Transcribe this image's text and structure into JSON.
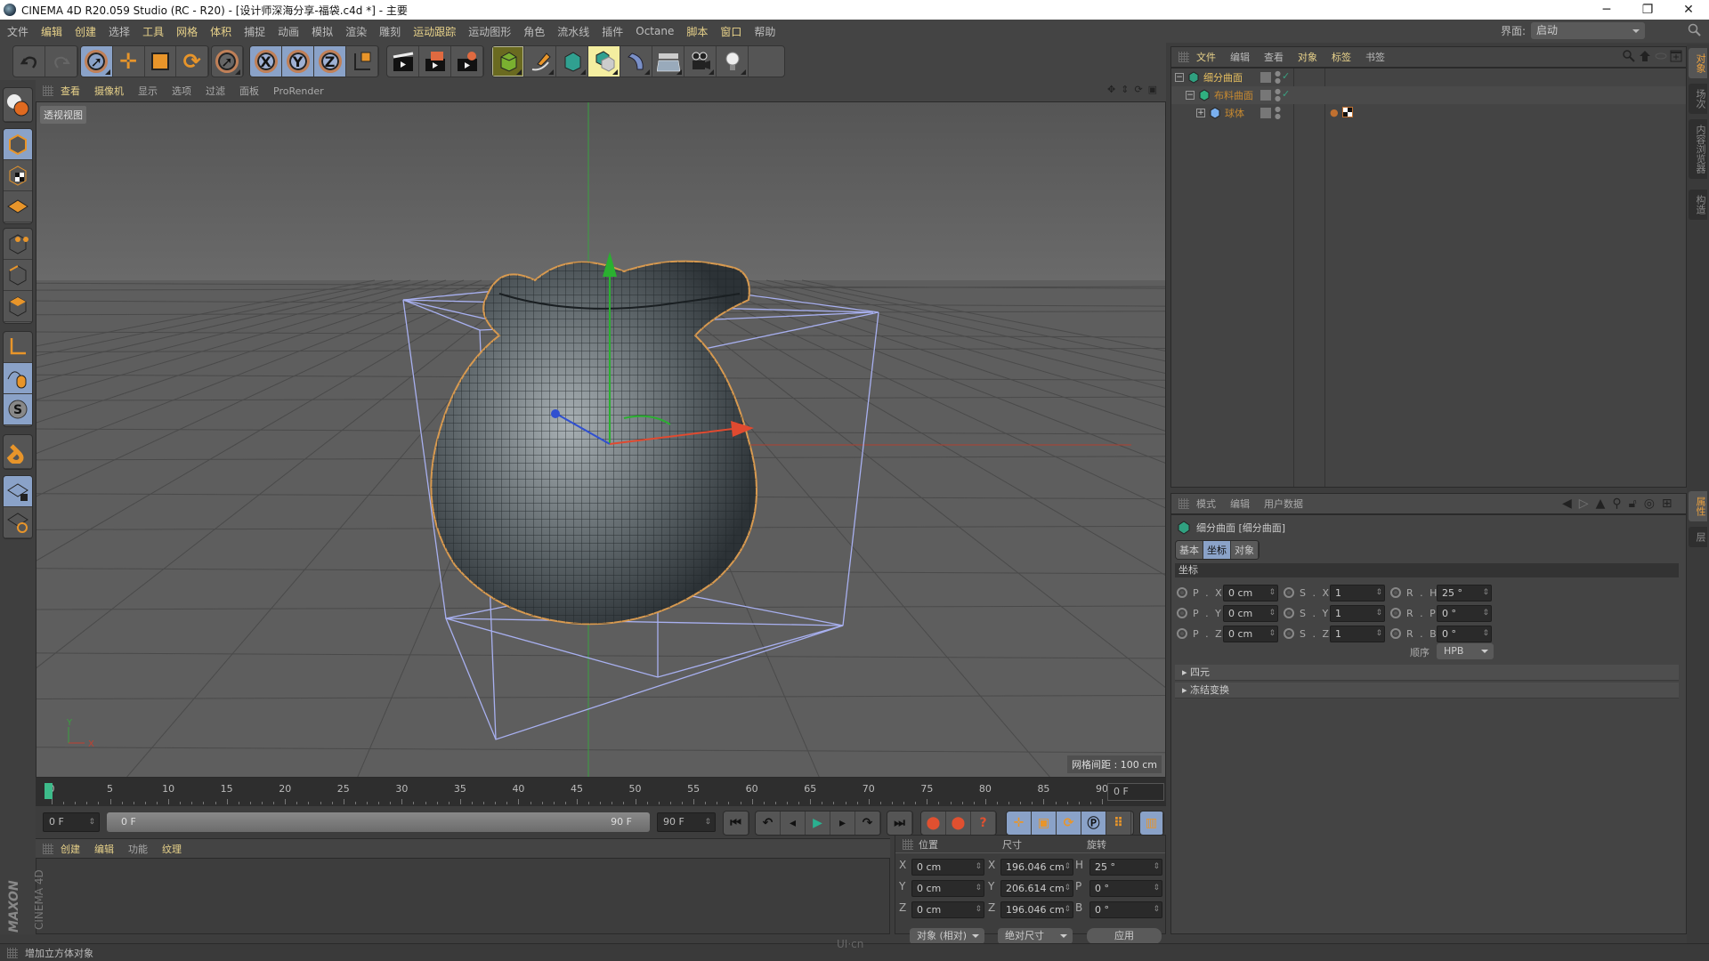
{
  "window": {
    "title": "CINEMA 4D R20.059 Studio (RC - R20) - [设计师深海分享-福袋.c4d *] - 主要",
    "controls": {
      "minimize": "─",
      "restore": "❐",
      "close": "✕"
    }
  },
  "menubar": {
    "items": [
      {
        "label": "文件",
        "hl": false
      },
      {
        "label": "编辑",
        "hl": true
      },
      {
        "label": "创建",
        "hl": true
      },
      {
        "label": "选择",
        "hl": false
      },
      {
        "label": "工具",
        "hl": true
      },
      {
        "label": "网格",
        "hl": true
      },
      {
        "label": "体积",
        "hl": true
      },
      {
        "label": "捕捉",
        "hl": false
      },
      {
        "label": "动画",
        "hl": false
      },
      {
        "label": "模拟",
        "hl": false
      },
      {
        "label": "渲染",
        "hl": false
      },
      {
        "label": "雕刻",
        "hl": false
      },
      {
        "label": "运动跟踪",
        "hl": true
      },
      {
        "label": "运动图形",
        "hl": false
      },
      {
        "label": "角色",
        "hl": false
      },
      {
        "label": "流水线",
        "hl": false
      },
      {
        "label": "插件",
        "hl": false
      },
      {
        "label": "Octane",
        "hl": false
      },
      {
        "label": "脚本",
        "hl": true
      },
      {
        "label": "窗口",
        "hl": true
      },
      {
        "label": "帮助",
        "hl": false
      }
    ],
    "layout_label": "界面:",
    "layout_value": "启动"
  },
  "toolbar": {
    "icons": [
      "undo-icon",
      "redo-icon",
      "live-selection-icon",
      "move-icon",
      "scale-icon",
      "rotate-icon",
      "recent-tool-icon",
      "x-axis-lock-icon",
      "y-axis-lock-icon",
      "z-axis-lock-icon",
      "coordinate-system-icon",
      "render-view-icon",
      "render-picture-viewer-icon",
      "render-settings-icon",
      "cube-icon",
      "pen-spline-icon",
      "subdivision-surface-icon",
      "cloner-icon",
      "deformer-icon",
      "floor-icon",
      "camera-icon",
      "light-icon"
    ],
    "axis_labels": [
      "X",
      "Y",
      "Z"
    ]
  },
  "leftbar": {
    "icons": [
      "make-editable-icon",
      "model-mode-icon",
      "texture-mode-icon",
      "workplane-mode-icon",
      "points-mode-icon",
      "edges-mode-icon",
      "polygons-mode-icon",
      "axis-mode-icon",
      "tweak-mode-icon",
      "solo-icon",
      "snap-icon",
      "workplane-lock-icon",
      "workplane-align-icon"
    ]
  },
  "viewport": {
    "menu": [
      {
        "label": "查看",
        "hl": true
      },
      {
        "label": "摄像机",
        "hl": true
      },
      {
        "label": "显示",
        "hl": false
      },
      {
        "label": "选项",
        "hl": false
      },
      {
        "label": "过滤",
        "hl": false
      },
      {
        "label": "面板",
        "hl": false
      },
      {
        "label": "ProRender",
        "hl": false
      }
    ],
    "view_name": "透视视图",
    "grid_spacing": "网格间距 : 100 cm",
    "axis_labels": {
      "x": "X",
      "y": "Y",
      "z": "Z"
    }
  },
  "timeline": {
    "ticks": [
      0,
      5,
      10,
      15,
      20,
      25,
      30,
      35,
      40,
      45,
      50,
      55,
      60,
      65,
      70,
      75,
      80,
      85,
      90
    ],
    "current_frame": "0 F",
    "start_field": "0 F",
    "range_start": "0 F",
    "range_end": "90 F",
    "end_field": "90 F",
    "max_frame": 90
  },
  "material_panel": {
    "menu": [
      {
        "label": "创建",
        "hl": true
      },
      {
        "label": "编辑",
        "hl": true
      },
      {
        "label": "功能",
        "hl": false
      },
      {
        "label": "纹理",
        "hl": true
      }
    ],
    "brand_top": "MAXON",
    "brand_bottom": "CINEMA 4D"
  },
  "coordinates": {
    "headers": {
      "position": "位置",
      "size": "尺寸",
      "rotation": "旋转"
    },
    "rows": [
      {
        "axis": "X",
        "pos": "0 cm",
        "size_axis": "X",
        "size": "196.046 cm",
        "rot_axis": "H",
        "rot": "25 °"
      },
      {
        "axis": "Y",
        "pos": "0 cm",
        "size_axis": "Y",
        "size": "206.614 cm",
        "rot_axis": "P",
        "rot": "0 °"
      },
      {
        "axis": "Z",
        "pos": "0 cm",
        "size_axis": "Z",
        "size": "196.046 cm",
        "rot_axis": "B",
        "rot": "0 °"
      }
    ],
    "mode_dropdown": "对象 (相对)",
    "size_dropdown": "绝对尺寸",
    "apply_button": "应用"
  },
  "object_manager": {
    "menu": [
      {
        "label": "文件",
        "hl": true
      },
      {
        "label": "编辑",
        "hl": false
      },
      {
        "label": "查看",
        "hl": false
      },
      {
        "label": "对象",
        "hl": true
      },
      {
        "label": "标签",
        "hl": true
      },
      {
        "label": "书签",
        "hl": false
      }
    ],
    "objects": [
      {
        "name": "细分曲面",
        "color": "#e8c060",
        "indent": 0,
        "expand": "−",
        "enabled": true
      },
      {
        "name": "布料曲面",
        "color": "#c88a30",
        "indent": 1,
        "expand": "−",
        "enabled": true
      },
      {
        "name": "球体",
        "color": "#c88a30",
        "indent": 2,
        "expand": "+",
        "enabled": false
      }
    ]
  },
  "right_tabs": {
    "top": [
      {
        "label": "对象",
        "active": true
      },
      {
        "label": "场次",
        "active": false
      },
      {
        "label": "内容浏览器",
        "active": false
      },
      {
        "label": "构造",
        "active": false
      }
    ],
    "bottom": [
      {
        "label": "属性",
        "active": true
      },
      {
        "label": "层",
        "active": false
      }
    ]
  },
  "attribute_manager": {
    "menu": [
      "模式",
      "编辑",
      "用户数据"
    ],
    "object_title": "细分曲面 [细分曲面]",
    "tabs": [
      {
        "label": "基本",
        "active": false
      },
      {
        "label": "坐标",
        "active": true
      },
      {
        "label": "对象",
        "active": false
      }
    ],
    "section": "坐标",
    "params": [
      [
        {
          "label": "P . X",
          "value": "0 cm"
        },
        {
          "label": "S . X",
          "value": "1"
        },
        {
          "label": "R . H",
          "value": "25 °"
        }
      ],
      [
        {
          "label": "P . Y",
          "value": "0 cm"
        },
        {
          "label": "S . Y",
          "value": "1"
        },
        {
          "label": "R . P",
          "value": "0 °"
        }
      ],
      [
        {
          "label": "P . Z",
          "value": "0 cm"
        },
        {
          "label": "S . Z",
          "value": "1"
        },
        {
          "label": "R . B",
          "value": "0 °"
        }
      ]
    ],
    "order_label": "顺序",
    "order_value": "HPB",
    "folds": [
      "四元",
      "冻结变换"
    ]
  },
  "status": {
    "message": "增加立方体对象",
    "watermark": "UI·cn"
  }
}
